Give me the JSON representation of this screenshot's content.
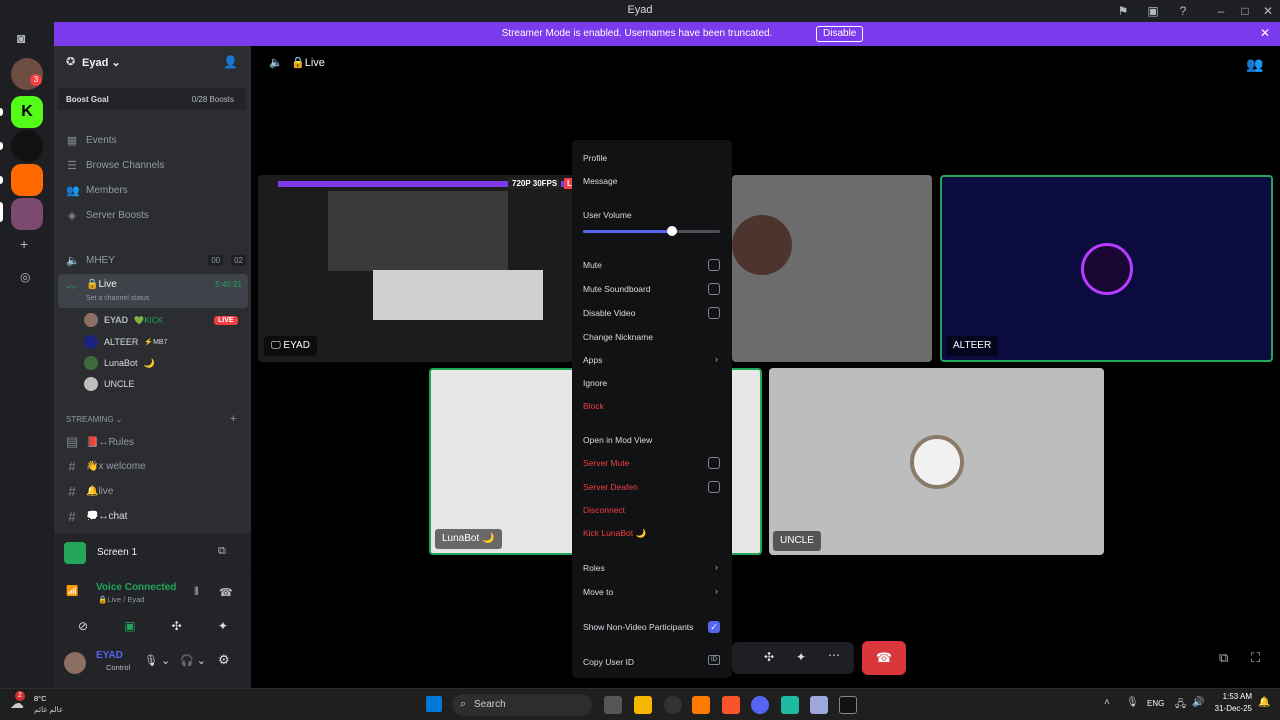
{
  "titlebar": {
    "title": "Eyad"
  },
  "banner": {
    "message": "Streamer Mode is enabled. Usernames have been truncated.",
    "disable_label": "Disable"
  },
  "server": {
    "name": "Eyad",
    "boost_goal": "Boost Goal",
    "boosts": "0/28 Boosts"
  },
  "nav": {
    "events": "Events",
    "browse": "Browse Channels",
    "members": "Members",
    "boosts": "Server Boosts"
  },
  "voice": {
    "mhey": "MHEY",
    "mhey_count_a": "00",
    "mhey_count_b": "02",
    "live": "Live",
    "live_timer": "5:40:21",
    "status_hint": "Set a channel status",
    "users": [
      {
        "name": "EYAD",
        "tag": "KICK",
        "badge": "LIVE"
      },
      {
        "name": "ALTEER",
        "tag": "MB7"
      },
      {
        "name": "LunaBot",
        "tag": "🌙"
      },
      {
        "name": "UNCLE",
        "tag": ""
      }
    ]
  },
  "category": {
    "streaming": "STREAMING"
  },
  "text_channels": [
    "📕↔Rules",
    "👋x welcome",
    "🔔live",
    "💭↔chat"
  ],
  "screen_panel": {
    "title": "Screen 1",
    "connected": "Voice Connected",
    "channel": "Live / Eyad",
    "username": "EYAD",
    "status": "Control"
  },
  "stage": {
    "channel": "Live",
    "stream_overlay": "720P 30FPS",
    "stream_live": "LIVE",
    "stream_name": "EYAD",
    "tiles": {
      "alteer": "ALTEER",
      "lunabot": "LunaBot 🌙",
      "uncle": "UNCLE"
    }
  },
  "context_menu": {
    "profile": "Profile",
    "message": "Message",
    "user_volume": "User Volume",
    "volume_level": 0.65,
    "mute": "Mute",
    "mute_soundboard": "Mute Soundboard",
    "disable_video": "Disable Video",
    "change_nickname": "Change Nickname",
    "apps": "Apps",
    "ignore": "Ignore",
    "block": "Block",
    "mod_view": "Open in Mod View",
    "server_mute": "Server Mute",
    "server_deafen": "Server Deafen",
    "disconnect": "Disconnect",
    "kick": "Kick LunaBot 🌙",
    "roles": "Roles",
    "move_to": "Move to",
    "show_non_video": "Show Non-Video Participants",
    "copy_id": "Copy User ID",
    "id_badge": "ID"
  },
  "taskbar": {
    "weather_temp": "8°C",
    "weather_desc": "عالم غائم",
    "search": "Search",
    "lang": "ENG",
    "time": "1:53 AM",
    "date": "31-Dec-25",
    "notif_count": "2"
  },
  "rail_badge": "3",
  "colors": {
    "accent": "#5865f2",
    "banner": "#7c3aed",
    "danger": "#f23f43",
    "green": "#23a55a"
  }
}
